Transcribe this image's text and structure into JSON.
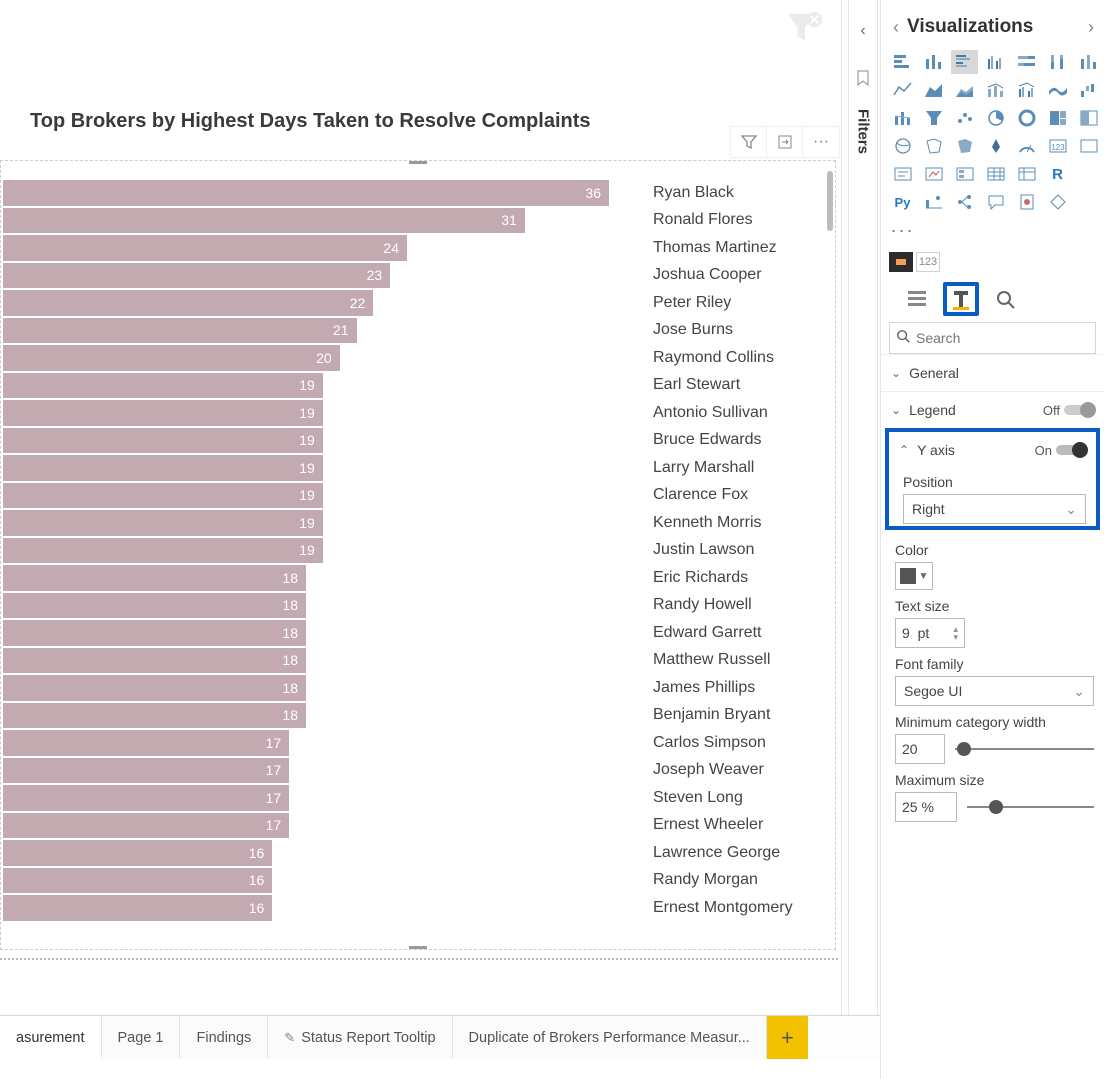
{
  "chart_data": {
    "type": "bar",
    "title": "Top Brokers by Highest Days Taken to Resolve Complaints",
    "xlabel": "",
    "ylabel": "",
    "categories": [
      "Ryan Black",
      "Ronald Flores",
      "Thomas Martinez",
      "Joshua Cooper",
      "Peter Riley",
      "Jose Burns",
      "Raymond Collins",
      "Earl Stewart",
      "Antonio Sullivan",
      "Bruce Edwards",
      "Larry Marshall",
      "Clarence Fox",
      "Kenneth Morris",
      "Justin Lawson",
      "Eric Richards",
      "Randy Howell",
      "Edward Garrett",
      "Matthew Russell",
      "James Phillips",
      "Benjamin Bryant",
      "Carlos Simpson",
      "Joseph Weaver",
      "Steven Long",
      "Ernest Wheeler",
      "Lawrence George",
      "Randy Morgan",
      "Ernest Montgomery"
    ],
    "values": [
      36,
      31,
      24,
      23,
      22,
      21,
      20,
      19,
      19,
      19,
      19,
      19,
      19,
      19,
      18,
      18,
      18,
      18,
      18,
      18,
      17,
      17,
      17,
      17,
      16,
      16,
      16
    ]
  },
  "chart_actions": {
    "filter": "Filter",
    "focus": "Focus mode",
    "more": "More options"
  },
  "filters_pane": {
    "label": "Filters"
  },
  "viz": {
    "title": "Visualizations",
    "search_placeholder": "Search",
    "little_tabs": {
      "values": "123"
    },
    "icons": {
      "py": "Py",
      "r": "R",
      "more": "···"
    },
    "sections": {
      "general": "General",
      "legend": "Legend",
      "legend_state": "Off",
      "yaxis": "Y axis",
      "yaxis_state": "On"
    },
    "yaxis": {
      "position_label": "Position",
      "position_value": "Right",
      "color_label": "Color",
      "textsize_label": "Text size",
      "textsize_value": "9",
      "textsize_unit": "pt",
      "font_label": "Font family",
      "font_value": "Segoe UI",
      "minw_label": "Minimum category width",
      "minw_value": "20",
      "maxs_label": "Maximum size",
      "maxs_value": "25",
      "maxs_unit": "%"
    }
  },
  "tabs": {
    "t0": "asurement",
    "t1": "Page 1",
    "t2": "Findings",
    "t3": "Status Report Tooltip",
    "t4": "Duplicate of Brokers Performance Measur...",
    "add": "+"
  }
}
